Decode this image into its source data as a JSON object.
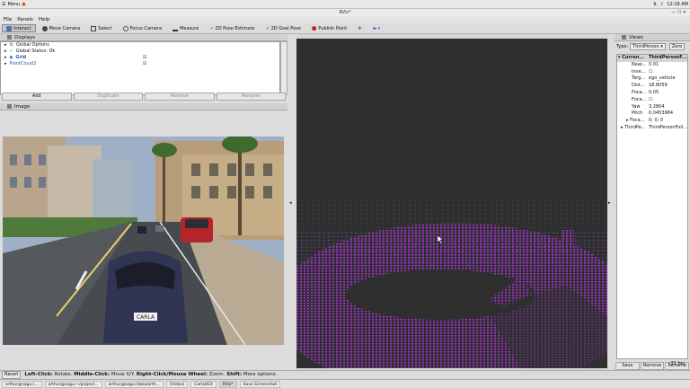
{
  "system": {
    "menu_label": "Menu",
    "time": "12:18 AM"
  },
  "window": {
    "title": "RViz*"
  },
  "menubar": [
    "File",
    "Panels",
    "Help"
  ],
  "toolbar": [
    "Interact",
    "Move Camera",
    "Select",
    "Focus Camera",
    "Measure",
    "2D Pose Estimate",
    "2D Goal Pose",
    "Publish Point"
  ],
  "displays": {
    "header": "Displays",
    "rows": [
      {
        "label": "Global Options",
        "value": ""
      },
      {
        "label": "Global Status: Ok",
        "value": ""
      },
      {
        "label": "Grid",
        "value": "☑"
      },
      {
        "label": "PointCloud2",
        "value": "☑"
      }
    ],
    "buttons": [
      "Add",
      "Duplicate",
      "Remove",
      "Rename"
    ]
  },
  "image_panel": {
    "header": "Image",
    "plate": "CARLA"
  },
  "views": {
    "header": "Views",
    "type_label": "Type:",
    "type_value": "ThirdPerson",
    "zero": "Zero",
    "current": {
      "key": "Curren...",
      "value": "ThirdPersonF..."
    },
    "props": [
      {
        "k": "Near...",
        "v": "0.01"
      },
      {
        "k": "Inve...",
        "v": "☐"
      },
      {
        "k": "Targ...",
        "v": "ego_vehicle"
      },
      {
        "k": "Dist...",
        "v": "18.8059"
      },
      {
        "k": "Foca...",
        "v": "0.05"
      },
      {
        "k": "Foca...",
        "v": "☐"
      },
      {
        "k": "Yaw",
        "v": "3.2804"
      },
      {
        "k": "Pitch",
        "v": "0.0453984"
      },
      {
        "k": "Foca...",
        "v": "0; 0; 0"
      }
    ],
    "third": {
      "key": "ThirdPe...",
      "value": "ThirdPersonFoll..."
    },
    "buttons": [
      "Save",
      "Remove",
      "Rename"
    ]
  },
  "status": {
    "reset": "Reset",
    "hint_bold1": "Left-Click:",
    "hint1": "Rotate.",
    "hint_bold2": "Middle-Click:",
    "hint2": "Move X/Y.",
    "hint_bold3": "Right-Click/Mouse Wheel:",
    "hint3": "Zoom.",
    "hint_bold4": "Shift:",
    "hint4": "More options.",
    "fps": "31 fps"
  },
  "taskbar": [
    "arthur@sagu:/...",
    "arthur@sagu:~/project...",
    "arthur@sagu:/data/arth...",
    "[Video]",
    "CarlaUE4",
    "RViz*",
    "Save Screenshot"
  ]
}
